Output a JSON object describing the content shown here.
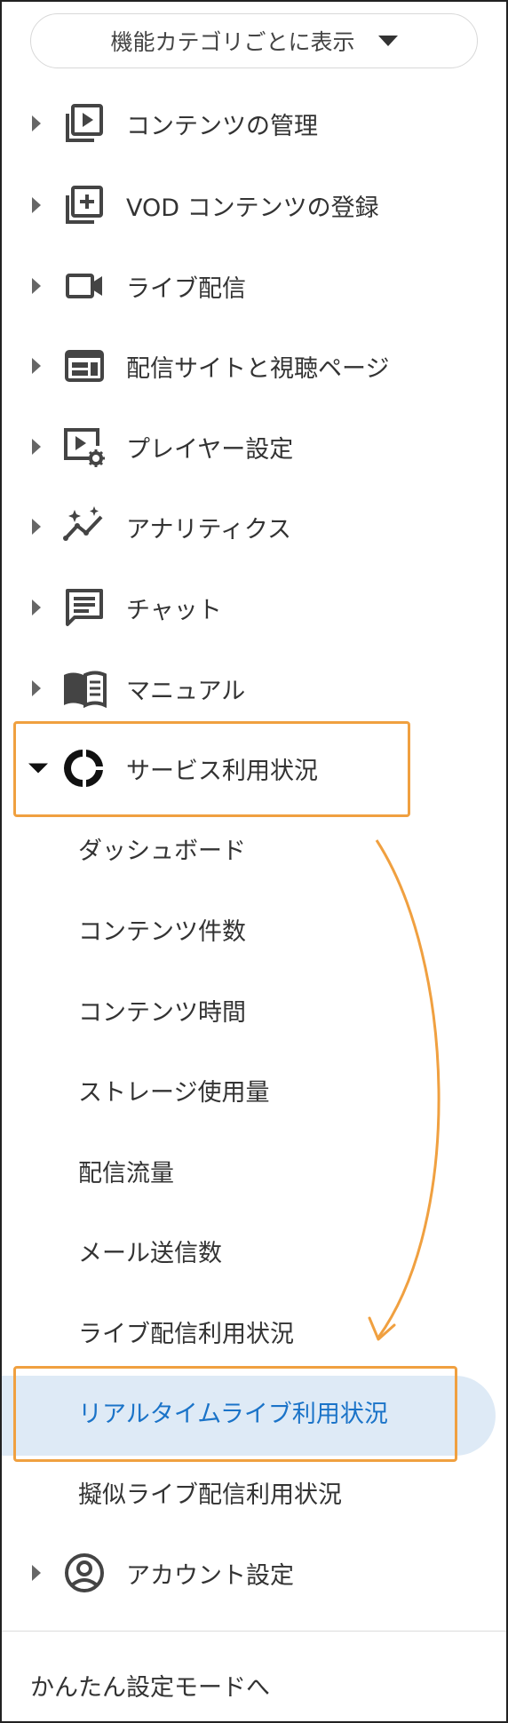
{
  "category_select": {
    "label": "機能カテゴリごとに表示"
  },
  "menu": [
    {
      "label": "コンテンツの管理",
      "icon": "video-library-icon"
    },
    {
      "label": "VOD コンテンツの登録",
      "icon": "add-to-library-icon"
    },
    {
      "label": "ライブ配信",
      "icon": "videocam-icon"
    },
    {
      "label": "配信サイトと視聴ページ",
      "icon": "web-page-icon"
    },
    {
      "label": "プレイヤー設定",
      "icon": "player-settings-icon"
    },
    {
      "label": "アナリティクス",
      "icon": "analytics-icon"
    },
    {
      "label": "チャット",
      "icon": "chat-icon"
    },
    {
      "label": "マニュアル",
      "icon": "manual-book-icon"
    },
    {
      "label": "サービス利用状況",
      "icon": "donut-chart-icon",
      "expanded": true
    }
  ],
  "submenu": [
    {
      "label": "ダッシュボード"
    },
    {
      "label": "コンテンツ件数"
    },
    {
      "label": "コンテンツ時間"
    },
    {
      "label": "ストレージ使用量"
    },
    {
      "label": "配信流量"
    },
    {
      "label": "メール送信数"
    },
    {
      "label": "ライブ配信利用状況"
    },
    {
      "label": "リアルタイムライブ利用状況",
      "active": true
    },
    {
      "label": "擬似ライブ配信利用状況"
    }
  ],
  "account": {
    "label": "アカウント設定",
    "icon": "account-circle-icon"
  },
  "bottom_link": {
    "label": "かんたん設定モードへ"
  },
  "colors": {
    "annotation": "#f0a040",
    "active_bg": "#deeaf6",
    "active_text": "#1a73c8"
  }
}
